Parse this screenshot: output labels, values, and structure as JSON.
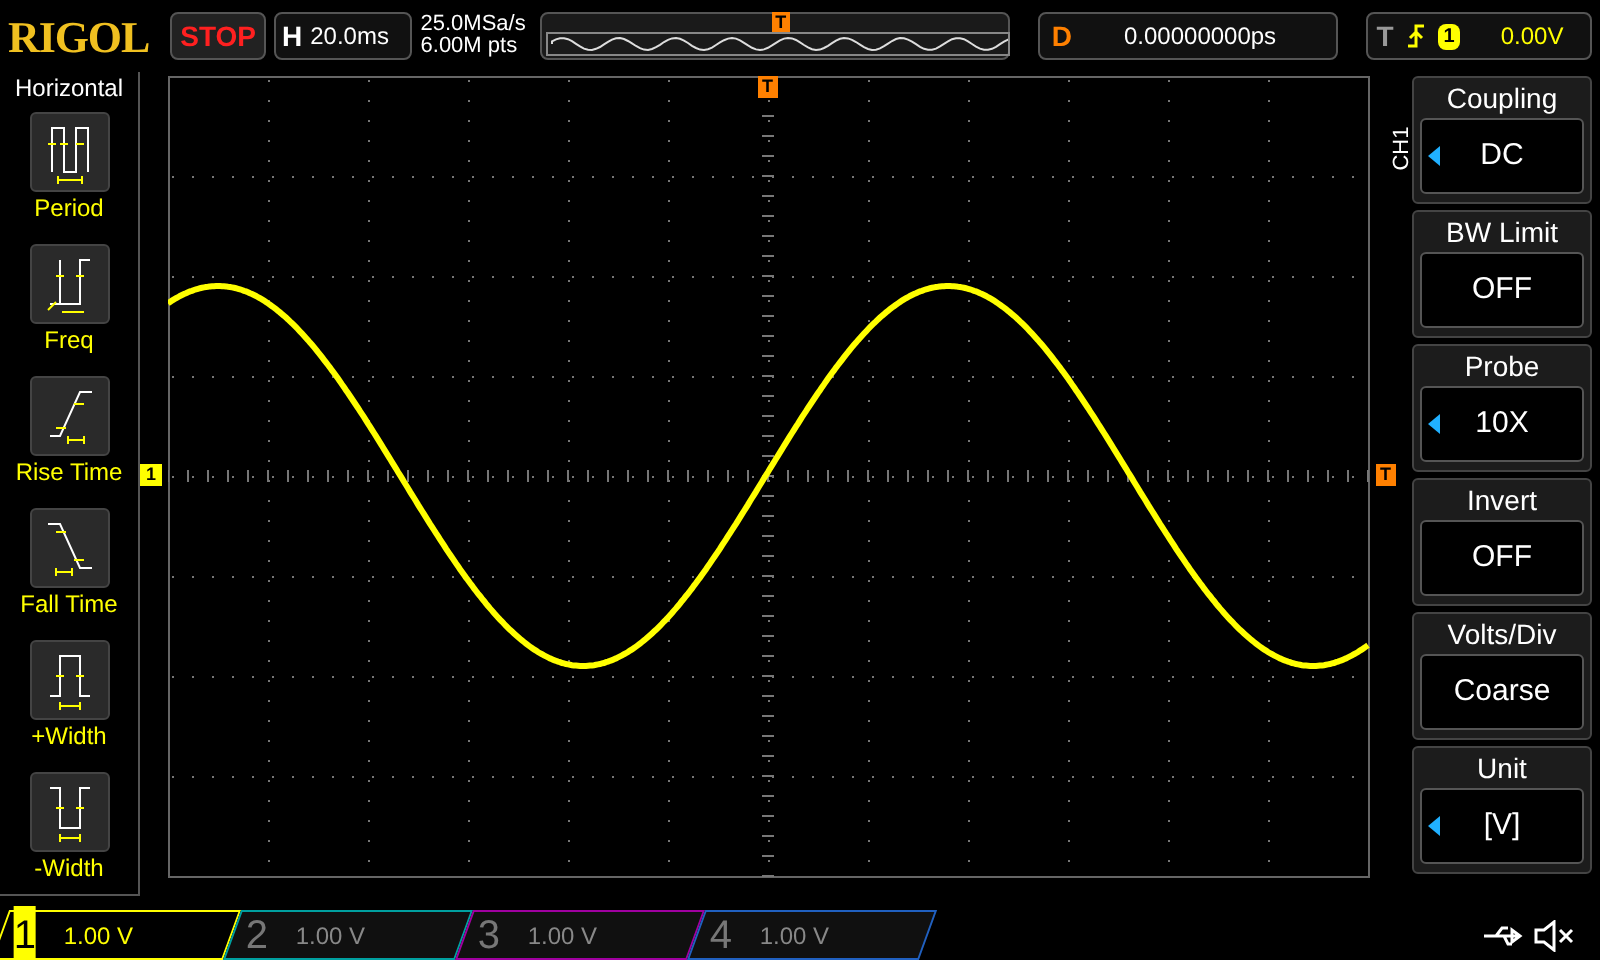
{
  "header": {
    "logo": "RIGOL",
    "run_state": "STOP",
    "timebase": {
      "label": "H",
      "value": "20.0ms"
    },
    "sample_rate": "25.0MSa/s",
    "memory_depth": "6.00M pts",
    "trigger_position_marker": "T",
    "delay": {
      "label": "D",
      "value": "0.00000000ps"
    },
    "trigger": {
      "label": "T",
      "source": "1",
      "level": "0.00V"
    }
  },
  "left_menu": {
    "title": "Horizontal",
    "items": [
      {
        "kind": "period",
        "label": "Period"
      },
      {
        "kind": "freq",
        "label": "Freq"
      },
      {
        "kind": "rise",
        "label": "Rise Time"
      },
      {
        "kind": "fall",
        "label": "Fall Time"
      },
      {
        "kind": "pwidth",
        "label": "+Width"
      },
      {
        "kind": "nwidth",
        "label": "-Width"
      }
    ]
  },
  "screen": {
    "trigger_marker": "T",
    "channel_marker": "1",
    "trigger_level_marker": "T"
  },
  "right_menu": {
    "channel": "CH1",
    "items": [
      {
        "label": "Coupling",
        "value": "DC",
        "adjustable": true
      },
      {
        "label": "BW Limit",
        "value": "OFF",
        "adjustable": false
      },
      {
        "label": "Probe",
        "value": "10X",
        "adjustable": true
      },
      {
        "label": "Invert",
        "value": "OFF",
        "adjustable": false
      },
      {
        "label": "Volts/Div",
        "value": "Coarse",
        "adjustable": false
      },
      {
        "label": "Unit",
        "value": "[V]",
        "adjustable": true
      }
    ]
  },
  "channels": [
    {
      "number": "1",
      "scale": "1.00 V",
      "selected": true,
      "color": "#ffff00"
    },
    {
      "number": "2",
      "scale": "1.00 V",
      "selected": false,
      "color": "#00a0a0"
    },
    {
      "number": "3",
      "scale": "1.00 V",
      "selected": false,
      "color": "#a000a0"
    },
    {
      "number": "4",
      "scale": "1.00 V",
      "selected": false,
      "color": "#2060c0"
    }
  ]
}
